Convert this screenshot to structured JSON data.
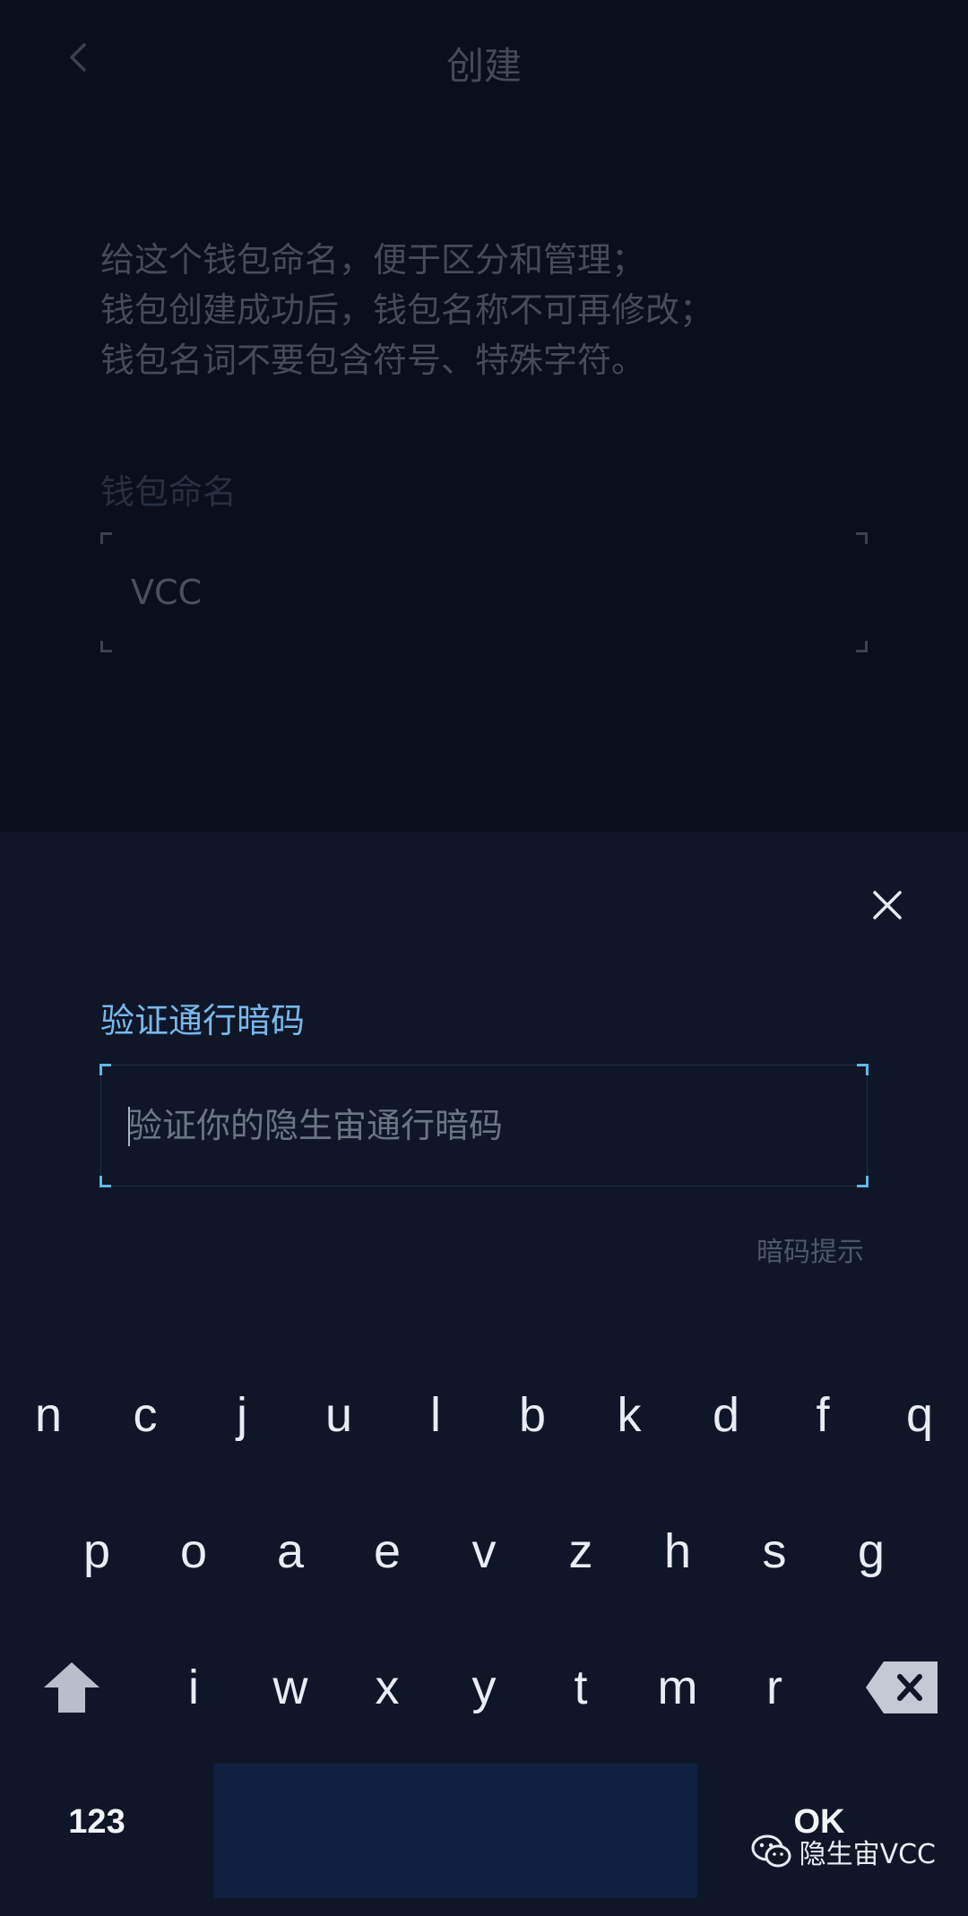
{
  "header": {
    "title": "创建",
    "back_icon": "chevron-left-icon"
  },
  "description": [
    "给这个钱包命名，便于区分和管理；",
    "钱包创建成功后，钱包名称不可再修改；",
    "钱包名词不要包含符号、特殊字符。"
  ],
  "wallet_name": {
    "label": "钱包命名",
    "value": "VCC"
  },
  "sheet": {
    "close_icon": "close-icon",
    "title": "验证通行暗码",
    "input_placeholder": "验证你的隐生宙通行暗码",
    "input_value": "",
    "hint_link": "暗码提示"
  },
  "keyboard": {
    "row1": [
      "n",
      "c",
      "j",
      "u",
      "l",
      "b",
      "k",
      "d",
      "f",
      "q"
    ],
    "row2": [
      "p",
      "o",
      "a",
      "e",
      "v",
      "z",
      "h",
      "s",
      "g"
    ],
    "row3": [
      "i",
      "w",
      "x",
      "y",
      "t",
      "m",
      "r"
    ],
    "numbers_key": "123",
    "ok_key": "OK",
    "shift_icon": "shift-up-arrow-icon",
    "backspace_icon": "backspace-icon"
  },
  "watermark": {
    "icon": "wechat-icon",
    "text": "隐生宙VCC"
  },
  "colors": {
    "accent": "#7ab8ea",
    "corner_accent": "#5fb8e6",
    "sheet_background": "#0e1628",
    "page_background": "#0b0e1b",
    "space_key": "#112041"
  }
}
